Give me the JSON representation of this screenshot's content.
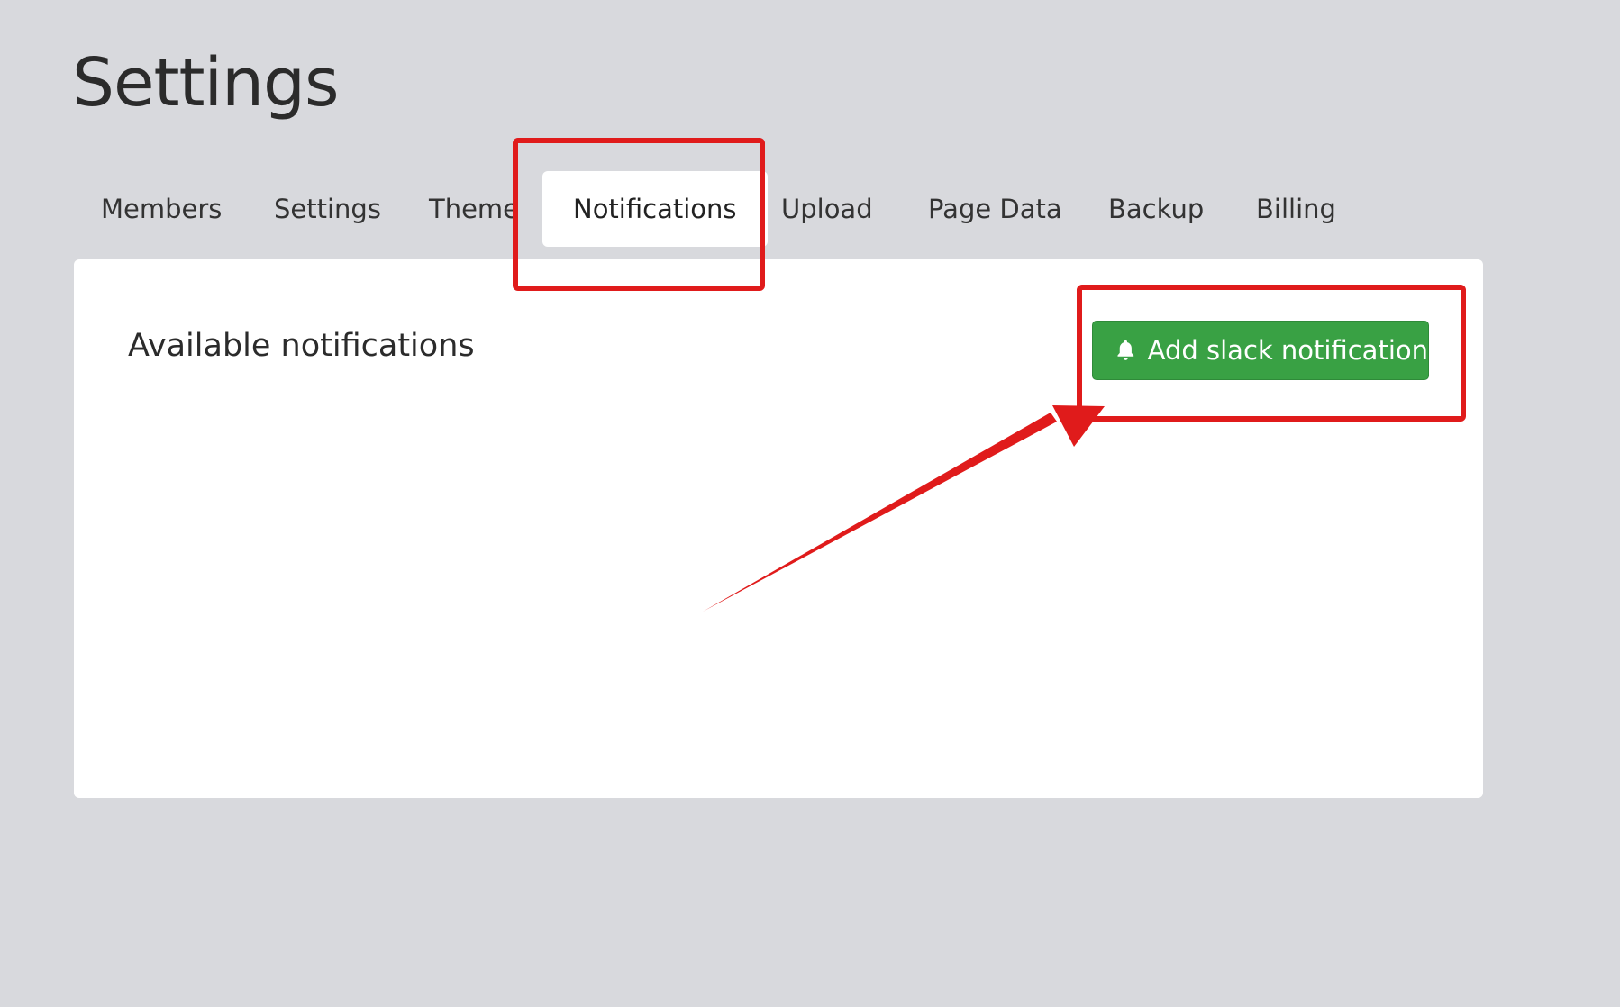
{
  "page": {
    "title": "Settings"
  },
  "tabs": [
    {
      "label": "Members"
    },
    {
      "label": "Settings"
    },
    {
      "label": "Theme"
    },
    {
      "label": "Notifications"
    },
    {
      "label": "Upload"
    },
    {
      "label": "Page Data"
    },
    {
      "label": "Backup"
    },
    {
      "label": "Billing"
    }
  ],
  "active_tab": "Notifications",
  "panel": {
    "title": "Available notifications",
    "add_button_label": "Add slack notification",
    "add_button_icon": "bell-icon"
  },
  "colors": {
    "background": "#d8d9dd",
    "panel": "#ffffff",
    "button_green": "#39a144",
    "annotation_red": "#e01b1b"
  }
}
